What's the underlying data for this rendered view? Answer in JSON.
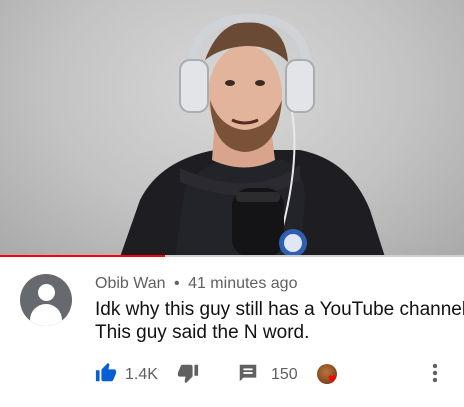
{
  "video": {
    "progress_fraction": 0.355,
    "accent_color": "#ff0000"
  },
  "comment": {
    "author": "Obib Wan",
    "separator": "•",
    "time_ago": "41 minutes ago",
    "text_lines": [
      "Idk why this guy still has a YouTube channel",
      "This guy said the N word."
    ],
    "likes": "1.4K",
    "replies": "150",
    "icons": {
      "avatar": "default-avatar-icon",
      "like": "thumbs-up-icon",
      "dislike": "thumbs-down-icon",
      "reply": "reply-icon",
      "creator_heart": "creator-heart-icon",
      "more": "more-vert-icon"
    },
    "like_color": "#065fd4"
  }
}
